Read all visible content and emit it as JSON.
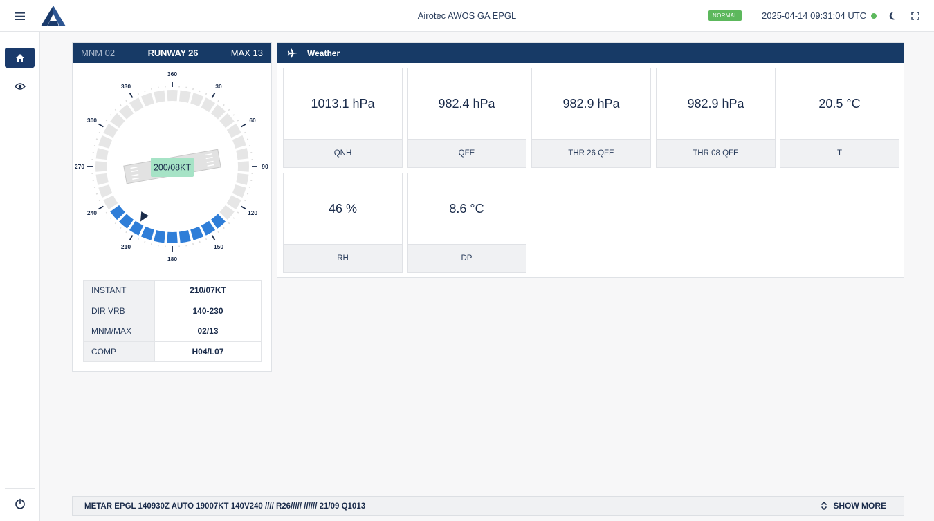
{
  "header": {
    "title": "Airotec AWOS GA EPGL",
    "status": "NORMAL",
    "datetime": "2025-04-14 09:31:04 UTC"
  },
  "icons": {
    "menu": "hamburger-menu-icon",
    "logo": "airotec-logo",
    "home": "home-icon",
    "eye": "eye-icon",
    "power": "power-icon",
    "theme": "moon-icon",
    "fullscreen": "fullscreen-icon",
    "plane": "airplane-icon",
    "expand": "chevron-up-down-icon"
  },
  "colors": {
    "primary": "#173a66",
    "ok": "#5cb85c",
    "variable_sector": "#2f7ed8",
    "wind_label_bg": "#a6e3c6"
  },
  "wind": {
    "header": {
      "minimum": "MNM 02",
      "runway": "RUNWAY 26",
      "maximum": "MAX 13"
    },
    "rose": {
      "labels": [
        "360",
        "30",
        "60",
        "90",
        "120",
        "150",
        "180",
        "210",
        "240",
        "270",
        "300",
        "330"
      ],
      "current_label": "200/08KT",
      "direction_deg": 210,
      "variable_from_deg": 140,
      "variable_to_deg": 230,
      "runway_heading_deg": 260
    },
    "table": [
      {
        "label": "INSTANT",
        "value": "210/07KT"
      },
      {
        "label": "DIR VRB",
        "value": "140-230"
      },
      {
        "label": "MNM/MAX",
        "value": "02/13"
      },
      {
        "label": "COMP",
        "value": "H04/L07"
      }
    ]
  },
  "weather": {
    "title": "Weather",
    "tiles": [
      {
        "value": "1013.1 hPa",
        "label": "QNH"
      },
      {
        "value": "982.4 hPa",
        "label": "QFE"
      },
      {
        "value": "982.9 hPa",
        "label": "THR 26 QFE"
      },
      {
        "value": "982.9 hPa",
        "label": "THR 08 QFE"
      },
      {
        "value": "20.5 °C",
        "label": "T"
      },
      {
        "value": "46 %",
        "label": "RH"
      },
      {
        "value": "8.6 °C",
        "label": "DP"
      }
    ]
  },
  "metar": {
    "text": "METAR EPGL 140930Z AUTO 19007KT 140V240 //// R26///// ////// 21/09 Q1013",
    "show_more": "SHOW MORE"
  }
}
